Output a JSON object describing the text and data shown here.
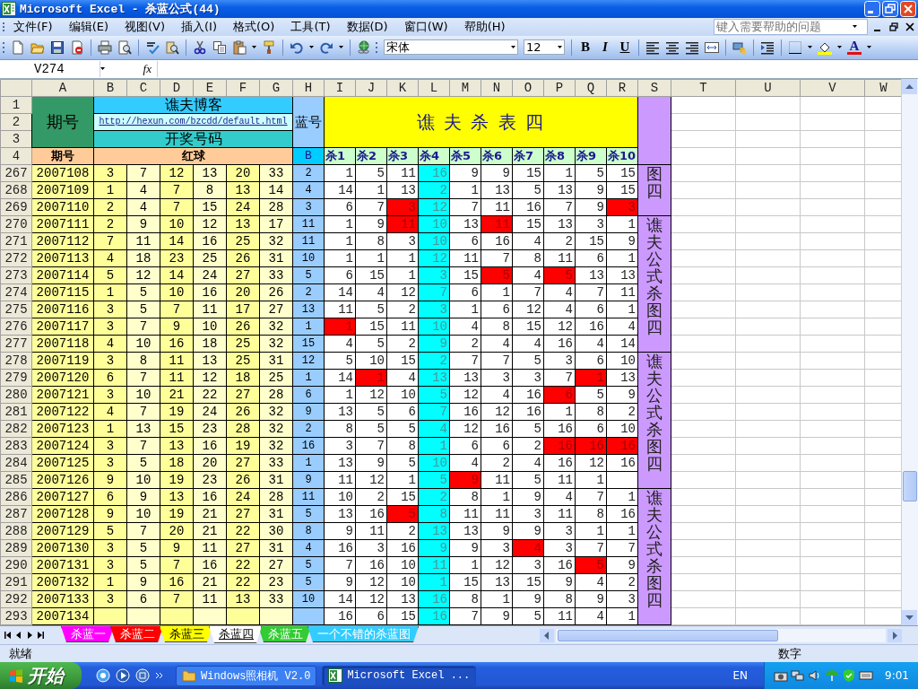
{
  "window": {
    "title": "Microsoft Excel - 杀蓝公式(44)"
  },
  "menu": [
    "文件(F)",
    "编辑(E)",
    "视图(V)",
    "插入(I)",
    "格式(O)",
    "工具(T)",
    "数据(D)",
    "窗口(W)",
    "帮助(H)"
  ],
  "help_box": {
    "placeholder": "键入需要帮助的问题"
  },
  "toolbar": {
    "font": "宋体",
    "size": "12",
    "format_buttons": [
      "B",
      "I",
      "U"
    ],
    "font_color_glyph": "A"
  },
  "formula_bar": {
    "name_box": "V274",
    "function_label": "fx"
  },
  "columns": [
    "A",
    "B",
    "C",
    "D",
    "E",
    "F",
    "G",
    "H",
    "I",
    "J",
    "K",
    "L",
    "M",
    "N",
    "O",
    "P",
    "Q",
    "R",
    "S",
    "T",
    "U",
    "V",
    "W"
  ],
  "header": {
    "row_numbers": [
      "1",
      "2",
      "3",
      "4"
    ],
    "period_title": "期号",
    "blog": "谯夫博客",
    "link": "http://hexun.com/bzcdd/default.html",
    "draw_numbers": "开奖号码",
    "blue_title": "蓝号",
    "kill_title": "谯 夫 杀 表 四",
    "period_label": "期号",
    "red_label": "红球",
    "blue_label": "B",
    "kill_labels": [
      "杀1",
      "杀2",
      "杀3",
      "杀4",
      "杀5",
      "杀6",
      "杀7",
      "杀8",
      "杀9",
      "杀10"
    ]
  },
  "rows": [
    {
      "num": "267",
      "period": "2007108",
      "reds": [
        "3",
        "7",
        "12",
        "13",
        "20",
        "33"
      ],
      "blue": "2",
      "kills": [
        "1",
        "5",
        "11",
        "16",
        "9",
        "9",
        "15",
        "1",
        "5",
        "15"
      ],
      "hits": [
        false,
        false,
        false,
        false,
        false,
        false,
        false,
        false,
        false,
        false
      ]
    },
    {
      "num": "268",
      "period": "2007109",
      "reds": [
        "1",
        "4",
        "7",
        "8",
        "13",
        "14"
      ],
      "blue": "4",
      "kills": [
        "14",
        "1",
        "13",
        "2",
        "1",
        "13",
        "5",
        "13",
        "9",
        "15"
      ],
      "hits": [
        false,
        false,
        false,
        false,
        false,
        false,
        false,
        false,
        false,
        false
      ]
    },
    {
      "num": "269",
      "period": "2007110",
      "reds": [
        "2",
        "4",
        "7",
        "15",
        "24",
        "28"
      ],
      "blue": "3",
      "kills": [
        "6",
        "7",
        "3",
        "12",
        "7",
        "11",
        "16",
        "7",
        "9",
        "3"
      ],
      "hits": [
        false,
        false,
        true,
        false,
        false,
        false,
        false,
        false,
        false,
        true
      ]
    },
    {
      "num": "270",
      "period": "2007111",
      "reds": [
        "2",
        "9",
        "10",
        "12",
        "13",
        "17"
      ],
      "blue": "11",
      "kills": [
        "1",
        "9",
        "11",
        "10",
        "13",
        "11",
        "15",
        "13",
        "3",
        "1"
      ],
      "hits": [
        false,
        false,
        true,
        false,
        false,
        true,
        false,
        false,
        false,
        false
      ]
    },
    {
      "num": "271",
      "period": "2007112",
      "reds": [
        "7",
        "11",
        "14",
        "16",
        "25",
        "32"
      ],
      "blue": "11",
      "kills": [
        "1",
        "8",
        "3",
        "10",
        "6",
        "16",
        "4",
        "2",
        "15",
        "9"
      ],
      "hits": [
        false,
        false,
        false,
        false,
        false,
        false,
        false,
        false,
        false,
        false
      ]
    },
    {
      "num": "272",
      "period": "2007113",
      "reds": [
        "4",
        "18",
        "23",
        "25",
        "26",
        "31"
      ],
      "blue": "10",
      "kills": [
        "1",
        "1",
        "1",
        "12",
        "11",
        "7",
        "8",
        "11",
        "6",
        "1"
      ],
      "hits": [
        false,
        false,
        false,
        false,
        false,
        false,
        false,
        false,
        false,
        false
      ]
    },
    {
      "num": "273",
      "period": "2007114",
      "reds": [
        "5",
        "12",
        "14",
        "24",
        "27",
        "33"
      ],
      "blue": "5",
      "kills": [
        "6",
        "15",
        "1",
        "3",
        "15",
        "5",
        "4",
        "5",
        "13",
        "13"
      ],
      "hits": [
        false,
        false,
        false,
        false,
        false,
        true,
        false,
        true,
        false,
        false
      ]
    },
    {
      "num": "274",
      "period": "2007115",
      "reds": [
        "1",
        "5",
        "10",
        "16",
        "20",
        "26"
      ],
      "blue": "2",
      "kills": [
        "14",
        "4",
        "12",
        "7",
        "6",
        "1",
        "7",
        "4",
        "7",
        "11"
      ],
      "hits": [
        false,
        false,
        false,
        false,
        false,
        false,
        false,
        false,
        false,
        false
      ]
    },
    {
      "num": "275",
      "period": "2007116",
      "reds": [
        "3",
        "5",
        "7",
        "11",
        "17",
        "27"
      ],
      "blue": "13",
      "kills": [
        "11",
        "5",
        "2",
        "3",
        "1",
        "6",
        "12",
        "4",
        "6",
        "1"
      ],
      "hits": [
        false,
        false,
        false,
        false,
        false,
        false,
        false,
        false,
        false,
        false
      ]
    },
    {
      "num": "276",
      "period": "2007117",
      "reds": [
        "3",
        "7",
        "9",
        "10",
        "26",
        "32"
      ],
      "blue": "1",
      "kills": [
        "1",
        "15",
        "11",
        "10",
        "4",
        "8",
        "15",
        "12",
        "16",
        "4"
      ],
      "hits": [
        true,
        false,
        false,
        false,
        false,
        false,
        false,
        false,
        false,
        false
      ]
    },
    {
      "num": "277",
      "period": "2007118",
      "reds": [
        "4",
        "10",
        "16",
        "18",
        "25",
        "32"
      ],
      "blue": "15",
      "kills": [
        "4",
        "5",
        "2",
        "9",
        "2",
        "4",
        "4",
        "16",
        "4",
        "14"
      ],
      "hits": [
        false,
        false,
        false,
        false,
        false,
        false,
        false,
        false,
        false,
        false
      ]
    },
    {
      "num": "278",
      "period": "2007119",
      "reds": [
        "3",
        "8",
        "11",
        "13",
        "25",
        "31"
      ],
      "blue": "12",
      "kills": [
        "5",
        "10",
        "15",
        "2",
        "7",
        "7",
        "5",
        "3",
        "6",
        "10"
      ],
      "hits": [
        false,
        false,
        false,
        false,
        false,
        false,
        false,
        false,
        false,
        false
      ]
    },
    {
      "num": "279",
      "period": "2007120",
      "reds": [
        "6",
        "7",
        "11",
        "12",
        "18",
        "25"
      ],
      "blue": "1",
      "kills": [
        "14",
        "1",
        "4",
        "13",
        "13",
        "3",
        "3",
        "7",
        "1",
        "13"
      ],
      "hits": [
        false,
        true,
        false,
        false,
        false,
        false,
        false,
        false,
        true,
        false
      ]
    },
    {
      "num": "280",
      "period": "2007121",
      "reds": [
        "3",
        "10",
        "21",
        "22",
        "27",
        "28"
      ],
      "blue": "6",
      "kills": [
        "1",
        "12",
        "10",
        "5",
        "12",
        "4",
        "16",
        "6",
        "5",
        "9"
      ],
      "hits": [
        false,
        false,
        false,
        false,
        false,
        false,
        false,
        true,
        false,
        false
      ]
    },
    {
      "num": "281",
      "period": "2007122",
      "reds": [
        "4",
        "7",
        "19",
        "24",
        "26",
        "32"
      ],
      "blue": "9",
      "kills": [
        "13",
        "5",
        "6",
        "7",
        "16",
        "12",
        "16",
        "1",
        "8",
        "2"
      ],
      "hits": [
        false,
        false,
        false,
        false,
        false,
        false,
        false,
        false,
        false,
        false
      ]
    },
    {
      "num": "282",
      "period": "2007123",
      "reds": [
        "1",
        "13",
        "15",
        "23",
        "28",
        "32"
      ],
      "blue": "2",
      "kills": [
        "8",
        "5",
        "5",
        "4",
        "12",
        "16",
        "5",
        "16",
        "6",
        "10"
      ],
      "hits": [
        false,
        false,
        false,
        false,
        false,
        false,
        false,
        false,
        false,
        false
      ]
    },
    {
      "num": "283",
      "period": "2007124",
      "reds": [
        "3",
        "7",
        "13",
        "16",
        "19",
        "32"
      ],
      "blue": "16",
      "kills": [
        "3",
        "7",
        "8",
        "1",
        "6",
        "6",
        "2",
        "16",
        "16",
        "16"
      ],
      "hits": [
        false,
        false,
        false,
        false,
        false,
        false,
        false,
        true,
        true,
        true
      ]
    },
    {
      "num": "284",
      "period": "2007125",
      "reds": [
        "3",
        "5",
        "18",
        "20",
        "27",
        "33"
      ],
      "blue": "1",
      "kills": [
        "13",
        "9",
        "5",
        "10",
        "4",
        "2",
        "4",
        "16",
        "12",
        "16"
      ],
      "hits": [
        false,
        false,
        false,
        false,
        false,
        false,
        false,
        false,
        false,
        false
      ]
    },
    {
      "num": "285",
      "period": "2007126",
      "reds": [
        "9",
        "10",
        "19",
        "23",
        "26",
        "31"
      ],
      "blue": "9",
      "kills": [
        "11",
        "12",
        "1",
        "5",
        "9",
        "11",
        "5",
        "11",
        "1"
      ],
      "hits": [
        false,
        false,
        false,
        false,
        true,
        false,
        false,
        false,
        false
      ]
    },
    {
      "num": "286",
      "period": "2007127",
      "reds": [
        "6",
        "9",
        "13",
        "16",
        "24",
        "28"
      ],
      "blue": "11",
      "kills": [
        "10",
        "2",
        "15",
        "2",
        "8",
        "1",
        "9",
        "4",
        "7",
        "1"
      ],
      "hits": [
        false,
        false,
        false,
        false,
        false,
        false,
        false,
        false,
        false,
        false
      ]
    },
    {
      "num": "287",
      "period": "2007128",
      "reds": [
        "9",
        "10",
        "19",
        "21",
        "27",
        "31"
      ],
      "blue": "5",
      "kills": [
        "13",
        "16",
        "5",
        "8",
        "11",
        "11",
        "3",
        "11",
        "8",
        "16"
      ],
      "hits": [
        false,
        false,
        true,
        false,
        false,
        false,
        false,
        false,
        false,
        false
      ]
    },
    {
      "num": "288",
      "period": "2007129",
      "reds": [
        "5",
        "7",
        "20",
        "21",
        "22",
        "30"
      ],
      "blue": "8",
      "kills": [
        "9",
        "11",
        "2",
        "13",
        "13",
        "9",
        "9",
        "3",
        "1",
        "1"
      ],
      "hits": [
        false,
        false,
        false,
        false,
        false,
        false,
        false,
        false,
        false,
        false
      ]
    },
    {
      "num": "289",
      "period": "2007130",
      "reds": [
        "3",
        "5",
        "9",
        "11",
        "27",
        "31"
      ],
      "blue": "4",
      "kills": [
        "16",
        "3",
        "16",
        "9",
        "9",
        "3",
        "4",
        "3",
        "7",
        "7"
      ],
      "hits": [
        false,
        false,
        false,
        false,
        false,
        false,
        true,
        false,
        false,
        false
      ]
    },
    {
      "num": "290",
      "period": "2007131",
      "reds": [
        "3",
        "5",
        "7",
        "16",
        "22",
        "27"
      ],
      "blue": "5",
      "kills": [
        "7",
        "16",
        "10",
        "11",
        "1",
        "12",
        "3",
        "16",
        "5",
        "9"
      ],
      "hits": [
        false,
        false,
        false,
        false,
        false,
        false,
        false,
        false,
        true,
        false
      ]
    },
    {
      "num": "291",
      "period": "2007132",
      "reds": [
        "1",
        "9",
        "16",
        "21",
        "22",
        "23"
      ],
      "blue": "5",
      "kills": [
        "9",
        "12",
        "10",
        "1",
        "15",
        "13",
        "15",
        "9",
        "4",
        "2"
      ],
      "hits": [
        false,
        false,
        false,
        false,
        false,
        false,
        false,
        false,
        false,
        false
      ]
    },
    {
      "num": "292",
      "period": "2007133",
      "reds": [
        "3",
        "6",
        "7",
        "11",
        "13",
        "33"
      ],
      "blue": "10",
      "kills": [
        "14",
        "12",
        "13",
        "16",
        "8",
        "1",
        "9",
        "8",
        "9",
        "3"
      ],
      "hits": [
        false,
        false,
        false,
        false,
        false,
        false,
        false,
        false,
        false,
        false
      ]
    },
    {
      "num": "293",
      "period": "2007134",
      "kills": [
        "16",
        "6",
        "15",
        "16",
        "7",
        "9",
        "5",
        "11",
        "4",
        "1"
      ],
      "hits": [
        false,
        false,
        false,
        false,
        false,
        false,
        false,
        false,
        false,
        false
      ]
    }
  ],
  "side_labels": [
    "图四",
    "谯夫公式杀图四",
    "谯夫公式杀图四",
    "谯夫公式杀图四"
  ],
  "sheet_tabs": [
    {
      "label": "杀蓝一",
      "color": "#ff00ff",
      "selected": false
    },
    {
      "label": "杀蓝二",
      "color": "#ff0000",
      "selected": false
    },
    {
      "label": "杀蓝三",
      "color": "#ffff00",
      "selected": false
    },
    {
      "label": "杀蓝四",
      "selected": true
    },
    {
      "label": "杀蓝五",
      "color": "#33cc33",
      "selected": false
    },
    {
      "label": "一个不错的杀蓝图",
      "color": "#33ccff",
      "selected": false
    }
  ],
  "status_bar": {
    "status": "就绪",
    "mode": "数字"
  },
  "taskbar": {
    "start": "开始",
    "tasks": [
      {
        "label": "Windows照相机 V2.0",
        "kind": "folder",
        "selected": false
      },
      {
        "label": "Microsoft Excel ...",
        "kind": "excel",
        "selected": true
      }
    ],
    "language": "EN",
    "clock": "9:01"
  }
}
